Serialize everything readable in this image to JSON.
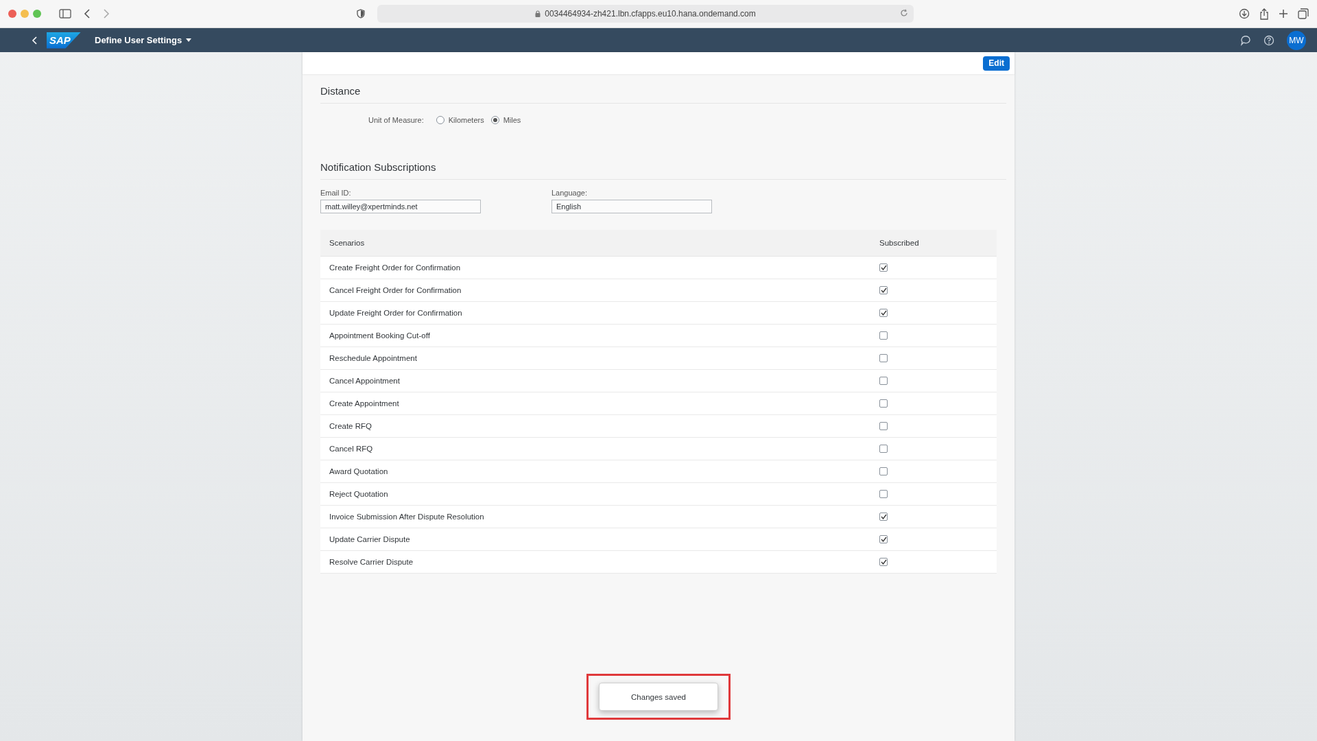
{
  "browser": {
    "url": "0034464934-zh421.lbn.cfapps.eu10.hana.ondemand.com"
  },
  "shell": {
    "logo": "SAP",
    "title": "Define User Settings",
    "avatar": "MW"
  },
  "toolbar": {
    "edit_button": "Edit"
  },
  "distance": {
    "heading": "Distance",
    "unit_label": "Unit of Measure:",
    "options": [
      {
        "label": "Kilometers",
        "selected": false
      },
      {
        "label": "Miles",
        "selected": true
      }
    ]
  },
  "notifications": {
    "heading": "Notification Subscriptions",
    "email": {
      "label": "Email ID:",
      "value": "matt.willey@xpertminds.net"
    },
    "language": {
      "label": "Language:",
      "value": "English"
    },
    "table": {
      "columns": [
        "Scenarios",
        "Subscribed"
      ],
      "rows": [
        {
          "scenario": "Create Freight Order for Confirmation",
          "subscribed": true
        },
        {
          "scenario": "Cancel Freight Order for Confirmation",
          "subscribed": true
        },
        {
          "scenario": "Update Freight Order for Confirmation",
          "subscribed": true
        },
        {
          "scenario": "Appointment Booking Cut-off",
          "subscribed": false
        },
        {
          "scenario": "Reschedule Appointment",
          "subscribed": false
        },
        {
          "scenario": "Cancel Appointment",
          "subscribed": false
        },
        {
          "scenario": "Create Appointment",
          "subscribed": false
        },
        {
          "scenario": "Create RFQ",
          "subscribed": false
        },
        {
          "scenario": "Cancel RFQ",
          "subscribed": false
        },
        {
          "scenario": "Award Quotation",
          "subscribed": false
        },
        {
          "scenario": "Reject Quotation",
          "subscribed": false
        },
        {
          "scenario": "Invoice Submission After Dispute Resolution",
          "subscribed": true
        },
        {
          "scenario": "Update Carrier Dispute",
          "subscribed": true
        },
        {
          "scenario": "Resolve Carrier Dispute",
          "subscribed": true
        }
      ]
    }
  },
  "toast": {
    "message": "Changes saved",
    "highlighted": true
  }
}
